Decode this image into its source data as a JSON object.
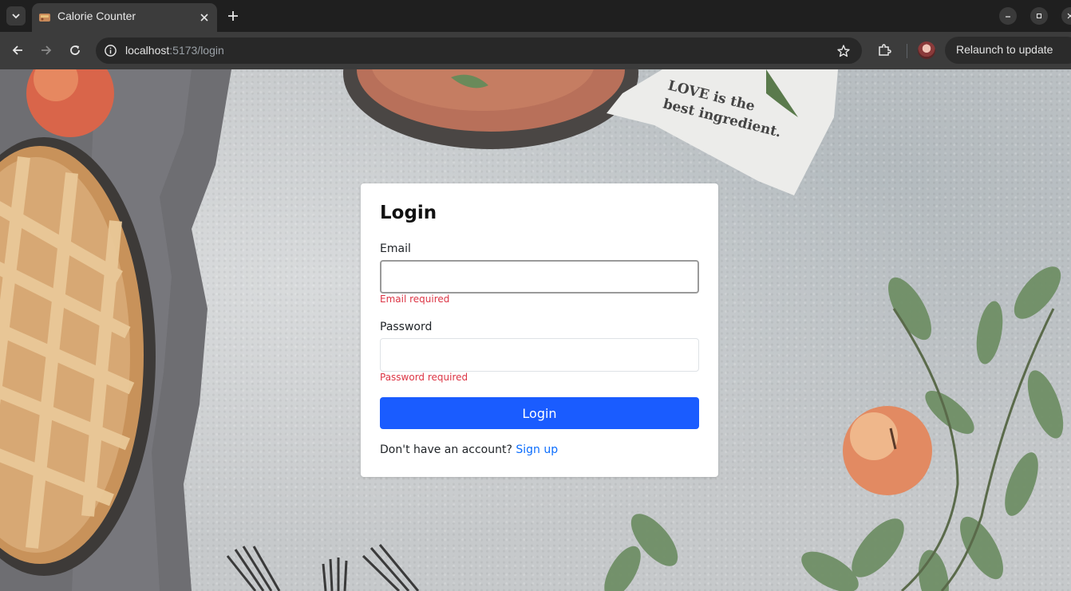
{
  "browser": {
    "tab_title": "Calorie Counter",
    "url_host": "localhost",
    "url_rest": ":5173/login",
    "relaunch_label": "Relaunch to update"
  },
  "background": {
    "towel_text_line1": "LOVE is the",
    "towel_text_line2": "best ingredient."
  },
  "login": {
    "title": "Login",
    "email_label": "Email",
    "email_value": "",
    "email_error": "Email required",
    "password_label": "Password",
    "password_value": "",
    "password_error": "Password required",
    "submit_label": "Login",
    "footer_text": "Don't have an account?",
    "signup_link": "Sign up"
  },
  "colors": {
    "primary": "#1a5cff",
    "error": "#dc3545",
    "link": "#0d6efd"
  }
}
